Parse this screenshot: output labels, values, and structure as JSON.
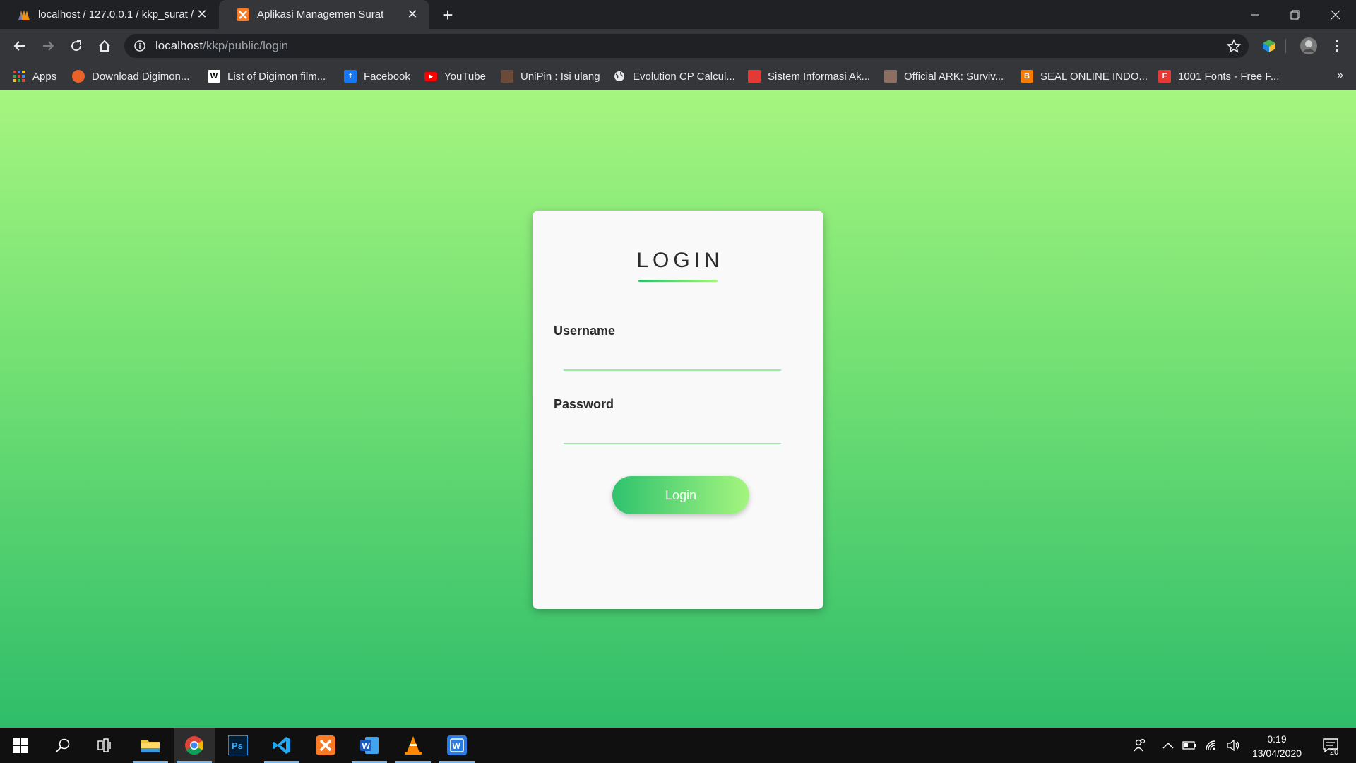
{
  "browser": {
    "tabs": [
      {
        "title": "localhost / 127.0.0.1 / kkp_surat / ",
        "active": false
      },
      {
        "title": "Aplikasi Managemen Surat",
        "active": true
      }
    ],
    "address": {
      "host": "localhost",
      "path": "/kkp/public/login"
    },
    "bookmarks": [
      {
        "label": "Apps",
        "icon": "apps-grid-icon"
      },
      {
        "label": "Download Digimon...",
        "icon": "digimon-icon",
        "color": "#e8622a"
      },
      {
        "label": "List of Digimon film...",
        "icon": "wikipedia-icon",
        "color": "#ffffff"
      },
      {
        "label": "Facebook",
        "icon": "facebook-icon",
        "color": "#1877f2"
      },
      {
        "label": "YouTube",
        "icon": "youtube-icon",
        "color": "#ff0000"
      },
      {
        "label": "UniPin : Isi ulang",
        "icon": "unipin-icon",
        "color": "#6b4a3a"
      },
      {
        "label": "Evolution CP Calcul...",
        "icon": "globe-icon",
        "color": "#e8eaed"
      },
      {
        "label": "Sistem Informasi Ak...",
        "icon": "sia-icon",
        "color": "#e53935"
      },
      {
        "label": "Official ARK: Surviv...",
        "icon": "ark-icon",
        "color": "#8d6e63"
      },
      {
        "label": "SEAL ONLINE INDO...",
        "icon": "blogger-icon",
        "color": "#f57c00"
      },
      {
        "label": "1001 Fonts - Free F...",
        "icon": "fonts-icon",
        "color": "#e53935"
      }
    ]
  },
  "login": {
    "heading": "LOGIN",
    "username_label": "Username",
    "username_value": "",
    "password_label": "Password",
    "password_value": "",
    "button_label": "Login"
  },
  "taskbar": {
    "time": "0:19",
    "date": "13/04/2020",
    "notifications": "20"
  },
  "colors": {
    "gradient_top": "#a5f57f",
    "gradient_bottom": "#2fbd6a",
    "card": "#f9f9f9"
  }
}
